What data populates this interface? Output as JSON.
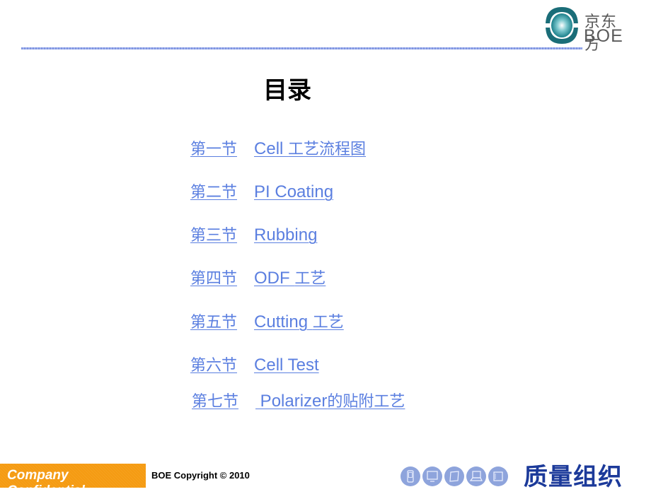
{
  "header": {
    "logo": {
      "icon": "boe-logo-icon",
      "text_cn": "京东方",
      "text_en": "BOE"
    }
  },
  "title": "目录",
  "toc": {
    "items": [
      {
        "section": "第一节",
        "name_en": "Cell ",
        "name_cn": "工艺流程图"
      },
      {
        "section": "第二节",
        "name_en": "PI Coating",
        "name_cn": ""
      },
      {
        "section": "第三节",
        "name_en": "Rubbing",
        "name_cn": ""
      },
      {
        "section": "第四节",
        "name_en": "ODF ",
        "name_cn": "工艺"
      },
      {
        "section": "第五节",
        "name_en": "Cutting ",
        "name_cn": "工艺"
      },
      {
        "section": "第六节",
        "name_en": "Cell Test",
        "name_cn": ""
      },
      {
        "section": "第七节",
        "name_en": " Polarizer",
        "name_cn": "的贴附工艺"
      }
    ],
    "link_color": "#5b7fe0"
  },
  "footer": {
    "confidential": "Company Confidential",
    "confidential_color": "#f59b12",
    "copyright": "BOE  Copyright © 2010",
    "icons": [
      "phone-icon",
      "monitor-icon",
      "tablet-icon",
      "laptop-icon",
      "display-icon"
    ],
    "slogan": "质量组织",
    "slogan_color": "#1c3a9a"
  }
}
